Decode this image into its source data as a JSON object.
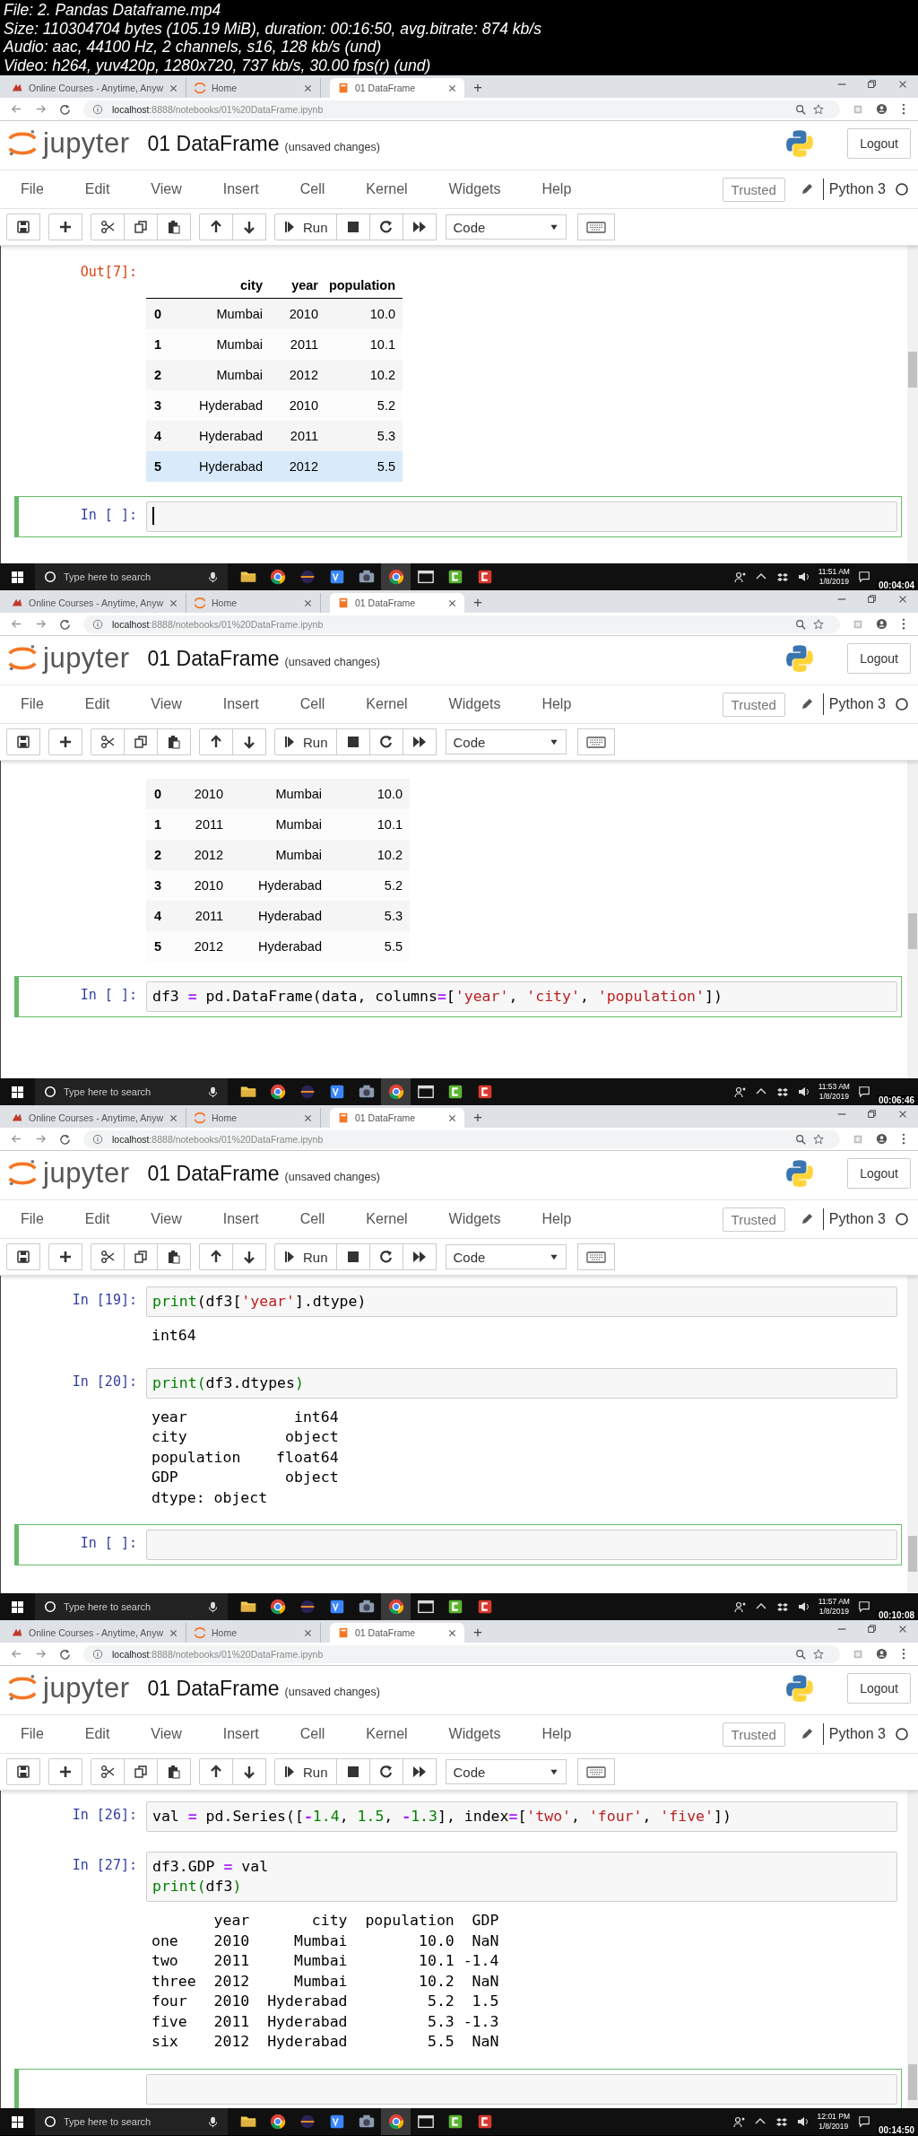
{
  "video_info": [
    "File: 2. Pandas Dataframe.mp4",
    "Size: 110304704 bytes (105.19 MiB), duration: 00:16:50, avg.bitrate: 874 kb/s",
    "Audio: aac, 44100 Hz, 2 channels, s16, 128 kb/s (und)",
    "Video: h264, yuv420p, 1280x720, 737 kb/s, 30.00 fps(r) (und)"
  ],
  "frames": [
    {
      "browser": {
        "tabs": [
          {
            "title": "Online Courses - Anytime, Anyw",
            "selected": false
          },
          {
            "title": "Home",
            "selected": false
          },
          {
            "title": "01 DataFrame",
            "selected": true
          }
        ],
        "new_tab": "+",
        "url_host": "localhost",
        "url_path": ":8888/notebooks/01%20DataFrame.ipynb"
      },
      "notebook": {
        "logo_text": "jupyter",
        "title": "01 DataFrame",
        "save_status": "(unsaved changes)",
        "logout": "Logout",
        "menu": [
          "File",
          "Edit",
          "View",
          "Insert",
          "Cell",
          "Kernel",
          "Widgets",
          "Help"
        ],
        "trusted": "Trusted",
        "kernel": "Python 3",
        "run": "Run",
        "cell_type": "Code"
      },
      "cells": [
        {
          "outputs": [
            {
              "kind": "table",
              "prompt": "Out[7]:",
              "columns": [
                "city",
                "year",
                "population"
              ],
              "rows": [
                {
                  "index": "0",
                  "cells": [
                    "Mumbai",
                    "2010",
                    "10.0"
                  ],
                  "hovered": false
                },
                {
                  "index": "1",
                  "cells": [
                    "Mumbai",
                    "2011",
                    "10.1"
                  ],
                  "hovered": false
                },
                {
                  "index": "2",
                  "cells": [
                    "Mumbai",
                    "2012",
                    "10.2"
                  ],
                  "hovered": false
                },
                {
                  "index": "3",
                  "cells": [
                    "Hyderabad",
                    "2010",
                    "5.2"
                  ],
                  "hovered": false
                },
                {
                  "index": "4",
                  "cells": [
                    "Hyderabad",
                    "2011",
                    "5.3"
                  ],
                  "hovered": false
                },
                {
                  "index": "5",
                  "cells": [
                    "Hyderabad",
                    "2012",
                    "5.5"
                  ],
                  "hovered": true
                }
              ]
            }
          ]
        },
        {
          "prompt": "In [ ]:",
          "selected": true,
          "cursor": true
        }
      ],
      "taskbar": {
        "search_placeholder": "Type here to search",
        "apps": [
          {
            "selected": false
          },
          {
            "selected": false
          },
          {
            "selected": false
          },
          {
            "selected": false
          },
          {
            "selected": false
          },
          {
            "selected": true
          },
          {
            "selected": false
          },
          {
            "selected": false
          },
          {
            "selected": false
          }
        ],
        "time": "11:51 AM",
        "date": "1/8/2019",
        "timestamp": "00:04:04"
      }
    },
    {
      "browser": {
        "tabs": [
          {
            "title": "Online Courses - Anytime, Anyw",
            "selected": false
          },
          {
            "title": "Home",
            "selected": false
          },
          {
            "title": "01 DataFrame",
            "selected": true
          }
        ],
        "new_tab": "+",
        "url_host": "localhost",
        "url_path": ":8888/notebooks/01%20DataFrame.ipynb"
      },
      "notebook": {
        "logo_text": "jupyter",
        "title": "01 DataFrame",
        "save_status": "(unsaved changes)",
        "logout": "Logout",
        "menu": [
          "File",
          "Edit",
          "View",
          "Insert",
          "Cell",
          "Kernel",
          "Widgets",
          "Help"
        ],
        "trusted": "Trusted",
        "kernel": "Python 3",
        "run": "Run",
        "cell_type": "Code"
      },
      "cells": [
        {
          "outputs": [
            {
              "kind": "table",
              "rows": [
                {
                  "index": "0",
                  "cells": [
                    "2010",
                    "Mumbai",
                    "10.0"
                  ],
                  "hovered": false
                },
                {
                  "index": "1",
                  "cells": [
                    "2011",
                    "Mumbai",
                    "10.1"
                  ],
                  "hovered": false
                },
                {
                  "index": "2",
                  "cells": [
                    "2012",
                    "Mumbai",
                    "10.2"
                  ],
                  "hovered": false
                },
                {
                  "index": "3",
                  "cells": [
                    "2010",
                    "Hyderabad",
                    "5.2"
                  ],
                  "hovered": false
                },
                {
                  "index": "4",
                  "cells": [
                    "2011",
                    "Hyderabad",
                    "5.3"
                  ],
                  "hovered": false
                },
                {
                  "index": "5",
                  "cells": [
                    "2012",
                    "Hyderabad",
                    "5.5"
                  ],
                  "hovered": false
                }
              ]
            }
          ]
        },
        {
          "prompt": "In [ ]:",
          "selected": true,
          "code": [
            [
              {
                "text": "df3 ",
                "kind": "text"
              },
              {
                "text": "=",
                "kind": "op"
              },
              {
                "text": " pd.DataFrame(data, columns",
                "kind": "text"
              },
              {
                "text": "=",
                "kind": "op"
              },
              {
                "text": "[",
                "kind": "text"
              },
              {
                "text": "'year'",
                "kind": "string"
              },
              {
                "text": ", ",
                "kind": "text"
              },
              {
                "text": "'city'",
                "kind": "string"
              },
              {
                "text": ", ",
                "kind": "text"
              },
              {
                "text": "'population'",
                "kind": "string"
              },
              {
                "text": "])",
                "kind": "text"
              }
            ]
          ]
        }
      ],
      "taskbar": {
        "search_placeholder": "Type here to search",
        "apps": [
          {
            "selected": false
          },
          {
            "selected": false
          },
          {
            "selected": false
          },
          {
            "selected": false
          },
          {
            "selected": false
          },
          {
            "selected": true
          },
          {
            "selected": false
          },
          {
            "selected": false
          },
          {
            "selected": false
          }
        ],
        "time": "11:53 AM",
        "date": "1/8/2019",
        "timestamp": "00:06:46"
      }
    },
    {
      "browser": {
        "tabs": [
          {
            "title": "Online Courses - Anytime, Anyw",
            "selected": false
          },
          {
            "title": "Home",
            "selected": false
          },
          {
            "title": "01 DataFrame",
            "selected": true
          }
        ],
        "new_tab": "+",
        "url_host": "localhost",
        "url_path": ":8888/notebooks/01%20DataFrame.ipynb"
      },
      "notebook": {
        "logo_text": "jupyter",
        "title": "01 DataFrame",
        "save_status": "(unsaved changes)",
        "logout": "Logout",
        "menu": [
          "File",
          "Edit",
          "View",
          "Insert",
          "Cell",
          "Kernel",
          "Widgets",
          "Help"
        ],
        "trusted": "Trusted",
        "kernel": "Python 3",
        "run": "Run",
        "cell_type": "Code"
      },
      "cells": [
        {
          "prompt": "In [19]:",
          "selected": false,
          "code": [
            [
              {
                "text": "print",
                "kind": "builtin"
              },
              {
                "text": "(df3[",
                "kind": "text"
              },
              {
                "text": "'year'",
                "kind": "string"
              },
              {
                "text": "].dtype)",
                "kind": "text"
              }
            ]
          ],
          "outputs": [
            {
              "kind": "stream",
              "lines": [
                "int64"
              ]
            }
          ]
        },
        {
          "prompt": "In [20]:",
          "selected": false,
          "code": [
            [
              {
                "text": "print(",
                "kind": "builtin"
              },
              {
                "text": "df3.dtypes",
                "kind": "text"
              },
              {
                "text": ")",
                "kind": "builtin"
              }
            ]
          ],
          "outputs": [
            {
              "kind": "stream",
              "lines": [
                "year            int64",
                "city           object",
                "population    float64",
                "GDP            object",
                "dtype: object"
              ]
            }
          ]
        },
        {
          "prompt": "In [ ]:",
          "selected": true
        }
      ],
      "taskbar": {
        "search_placeholder": "Type here to search",
        "apps": [
          {
            "selected": false
          },
          {
            "selected": false
          },
          {
            "selected": false
          },
          {
            "selected": false
          },
          {
            "selected": false
          },
          {
            "selected": true
          },
          {
            "selected": false
          },
          {
            "selected": false
          },
          {
            "selected": false
          }
        ],
        "time": "11:57 AM",
        "date": "1/8/2019",
        "timestamp": "00:10:08"
      }
    },
    {
      "browser": {
        "tabs": [
          {
            "title": "Online Courses - Anytime, Anyw",
            "selected": false
          },
          {
            "title": "Home",
            "selected": false
          },
          {
            "title": "01 DataFrame",
            "selected": true
          }
        ],
        "new_tab": "+",
        "url_host": "localhost",
        "url_path": ":8888/notebooks/01%20DataFrame.ipynb"
      },
      "notebook": {
        "logo_text": "jupyter",
        "title": "01 DataFrame",
        "save_status": "(unsaved changes)",
        "logout": "Logout",
        "menu": [
          "File",
          "Edit",
          "View",
          "Insert",
          "Cell",
          "Kernel",
          "Widgets",
          "Help"
        ],
        "trusted": "Trusted",
        "kernel": "Python 3",
        "run": "Run",
        "cell_type": "Code"
      },
      "cells": [
        {
          "prompt": "In [26]:",
          "selected": false,
          "code": [
            [
              {
                "text": "val ",
                "kind": "text"
              },
              {
                "text": "=",
                "kind": "op"
              },
              {
                "text": " pd.Series([",
                "kind": "text"
              },
              {
                "text": "-",
                "kind": "op"
              },
              {
                "text": "1.4",
                "kind": "number"
              },
              {
                "text": ", ",
                "kind": "text"
              },
              {
                "text": "1.5",
                "kind": "number"
              },
              {
                "text": ", ",
                "kind": "text"
              },
              {
                "text": "-",
                "kind": "op"
              },
              {
                "text": "1.3",
                "kind": "number"
              },
              {
                "text": "], index",
                "kind": "text"
              },
              {
                "text": "=",
                "kind": "op"
              },
              {
                "text": "[",
                "kind": "text"
              },
              {
                "text": "'two'",
                "kind": "string"
              },
              {
                "text": ", ",
                "kind": "text"
              },
              {
                "text": "'four'",
                "kind": "string"
              },
              {
                "text": ", ",
                "kind": "text"
              },
              {
                "text": "'five'",
                "kind": "string"
              },
              {
                "text": "])",
                "kind": "text"
              }
            ]
          ]
        },
        {
          "prompt": "In [27]:",
          "selected": false,
          "code": [
            [
              {
                "text": "df3.GDP ",
                "kind": "text"
              },
              {
                "text": "=",
                "kind": "op"
              },
              {
                "text": " val",
                "kind": "text"
              }
            ],
            [
              {
                "text": "print(",
                "kind": "builtin"
              },
              {
                "text": "df3",
                "kind": "text"
              },
              {
                "text": ")",
                "kind": "builtin"
              }
            ]
          ],
          "outputs": [
            {
              "kind": "stream",
              "lines": [
                "       year       city  population  GDP",
                "one    2010     Mumbai        10.0  NaN",
                "two    2011     Mumbai        10.1 -1.4",
                "three  2012     Mumbai        10.2  NaN",
                "four   2010  Hyderabad         5.2  1.5",
                "five   2011  Hyderabad         5.3 -1.3",
                "six    2012  Hyderabad         5.5  NaN"
              ]
            }
          ]
        },
        {
          "selected": true
        }
      ],
      "taskbar": {
        "search_placeholder": "Type here to search",
        "apps": [
          {
            "selected": false
          },
          {
            "selected": false
          },
          {
            "selected": false
          },
          {
            "selected": false
          },
          {
            "selected": false
          },
          {
            "selected": true
          },
          {
            "selected": false
          },
          {
            "selected": false
          },
          {
            "selected": false
          }
        ],
        "time": "12:01 PM",
        "date": "1/8/2019",
        "timestamp": "00:14:50"
      }
    }
  ]
}
